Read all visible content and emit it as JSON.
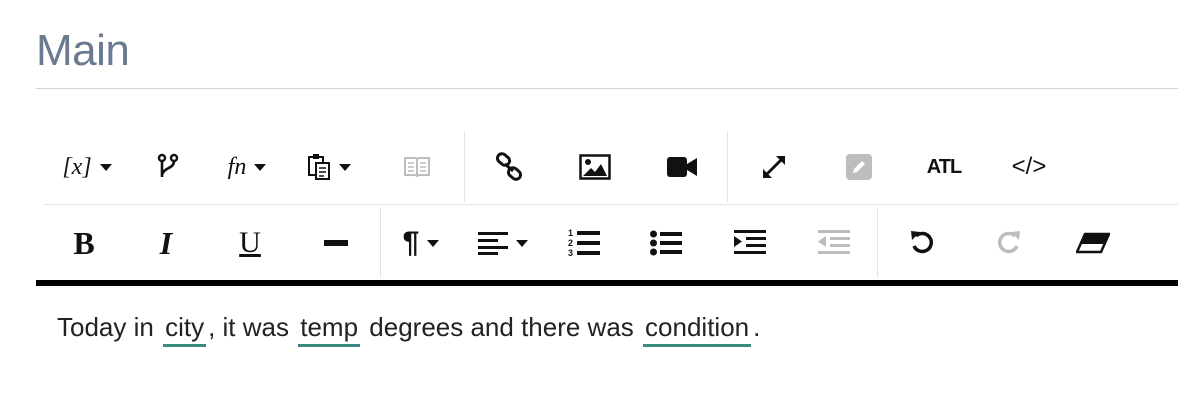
{
  "page": {
    "title": "Main"
  },
  "toolbar": {
    "row1": {
      "variable": {
        "label": "[x]",
        "icon": "variable-icon"
      },
      "branch": {
        "icon": "branch-icon"
      },
      "function": {
        "label": "fn",
        "icon": "function-icon"
      },
      "paste": {
        "icon": "paste-icon"
      },
      "book": {
        "icon": "book-icon",
        "disabled": true
      },
      "link": {
        "icon": "link-icon"
      },
      "image": {
        "icon": "image-icon"
      },
      "video": {
        "icon": "video-icon"
      },
      "fullscreen": {
        "icon": "expand-icon"
      },
      "edit": {
        "icon": "edit-icon",
        "disabled": true
      },
      "atl": {
        "label": "ATL"
      },
      "code": {
        "label": "</>"
      }
    },
    "row2": {
      "bold": {
        "label": "B"
      },
      "italic": {
        "label": "I"
      },
      "underline": {
        "label": "U"
      },
      "hr": {
        "icon": "horizontal-rule-icon"
      },
      "paragraph": {
        "label": "¶"
      },
      "align": {
        "icon": "align-left-icon"
      },
      "ordered_list": {
        "icon": "ordered-list-icon"
      },
      "bullet_list": {
        "icon": "bullet-list-icon"
      },
      "indent": {
        "icon": "indent-icon"
      },
      "outdent": {
        "icon": "outdent-icon",
        "disabled": true
      },
      "undo": {
        "icon": "undo-icon"
      },
      "redo": {
        "icon": "redo-icon",
        "disabled": true
      },
      "clear_format": {
        "icon": "eraser-icon"
      }
    }
  },
  "editor": {
    "text_1": "Today in",
    "var_city": "city",
    "text_2": ", it was",
    "var_temp": "temp",
    "text_3": "degrees and there was",
    "var_condition": "condition",
    "text_4": "."
  },
  "colors": {
    "accent": "#3a8a80",
    "title": "#6b7a90",
    "disabled": "#bdbdbd"
  }
}
